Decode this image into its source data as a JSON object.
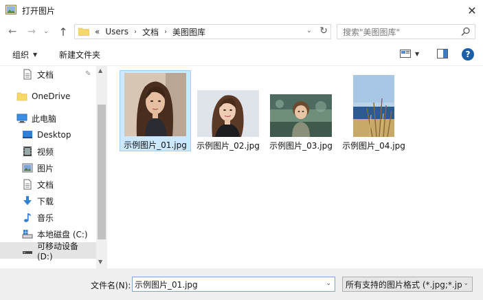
{
  "window": {
    "title": "打开图片"
  },
  "nav": {
    "back_glyph": "←",
    "forward_glyph": "→",
    "recent_glyph": "⌄",
    "up_glyph": "↑"
  },
  "address": {
    "overflow": "«",
    "segments": [
      "Users",
      "文档",
      "美图图库"
    ],
    "separator": "›",
    "dropdown_glyph": "⌄",
    "refresh_glyph": "↻"
  },
  "search": {
    "placeholder": "搜索\"美图图库\""
  },
  "toolbar": {
    "organize_label": "组织",
    "caret": "▼",
    "new_folder_label": "新建文件夹",
    "help_label": "?"
  },
  "sidebar": {
    "items": [
      {
        "label": "文档",
        "icon": "document-icon"
      },
      {
        "label": "OneDrive",
        "icon": "folder-icon"
      },
      {
        "label": "此电脑",
        "icon": "computer-icon"
      },
      {
        "label": "Desktop",
        "icon": "desktop-icon"
      },
      {
        "label": "视频",
        "icon": "video-icon"
      },
      {
        "label": "图片",
        "icon": "picture-icon"
      },
      {
        "label": "文档",
        "icon": "document-icon"
      },
      {
        "label": "下载",
        "icon": "download-icon"
      },
      {
        "label": "音乐",
        "icon": "music-icon"
      },
      {
        "label": "本地磁盘 (C:)",
        "icon": "drive-icon"
      },
      {
        "label": "可移动设备 (D:)",
        "icon": "removable-drive-icon"
      }
    ]
  },
  "files": [
    {
      "name": "示例图片_01.jpg"
    },
    {
      "name": "示例图片_02.jpg"
    },
    {
      "name": "示例图片_03.jpg"
    },
    {
      "name": "示例图片_04.jpg"
    }
  ],
  "bottom": {
    "filename_label": "文件名(N):",
    "filename_value": "示例图片_01.jpg",
    "filetype_value": "所有支持的图片格式 (*.jpg;*.jp",
    "caret": "⌄"
  },
  "colors": {
    "selection": "#cce8ff",
    "help_blue": "#1d5fa6",
    "folder_yellow": "#f7d86a"
  }
}
